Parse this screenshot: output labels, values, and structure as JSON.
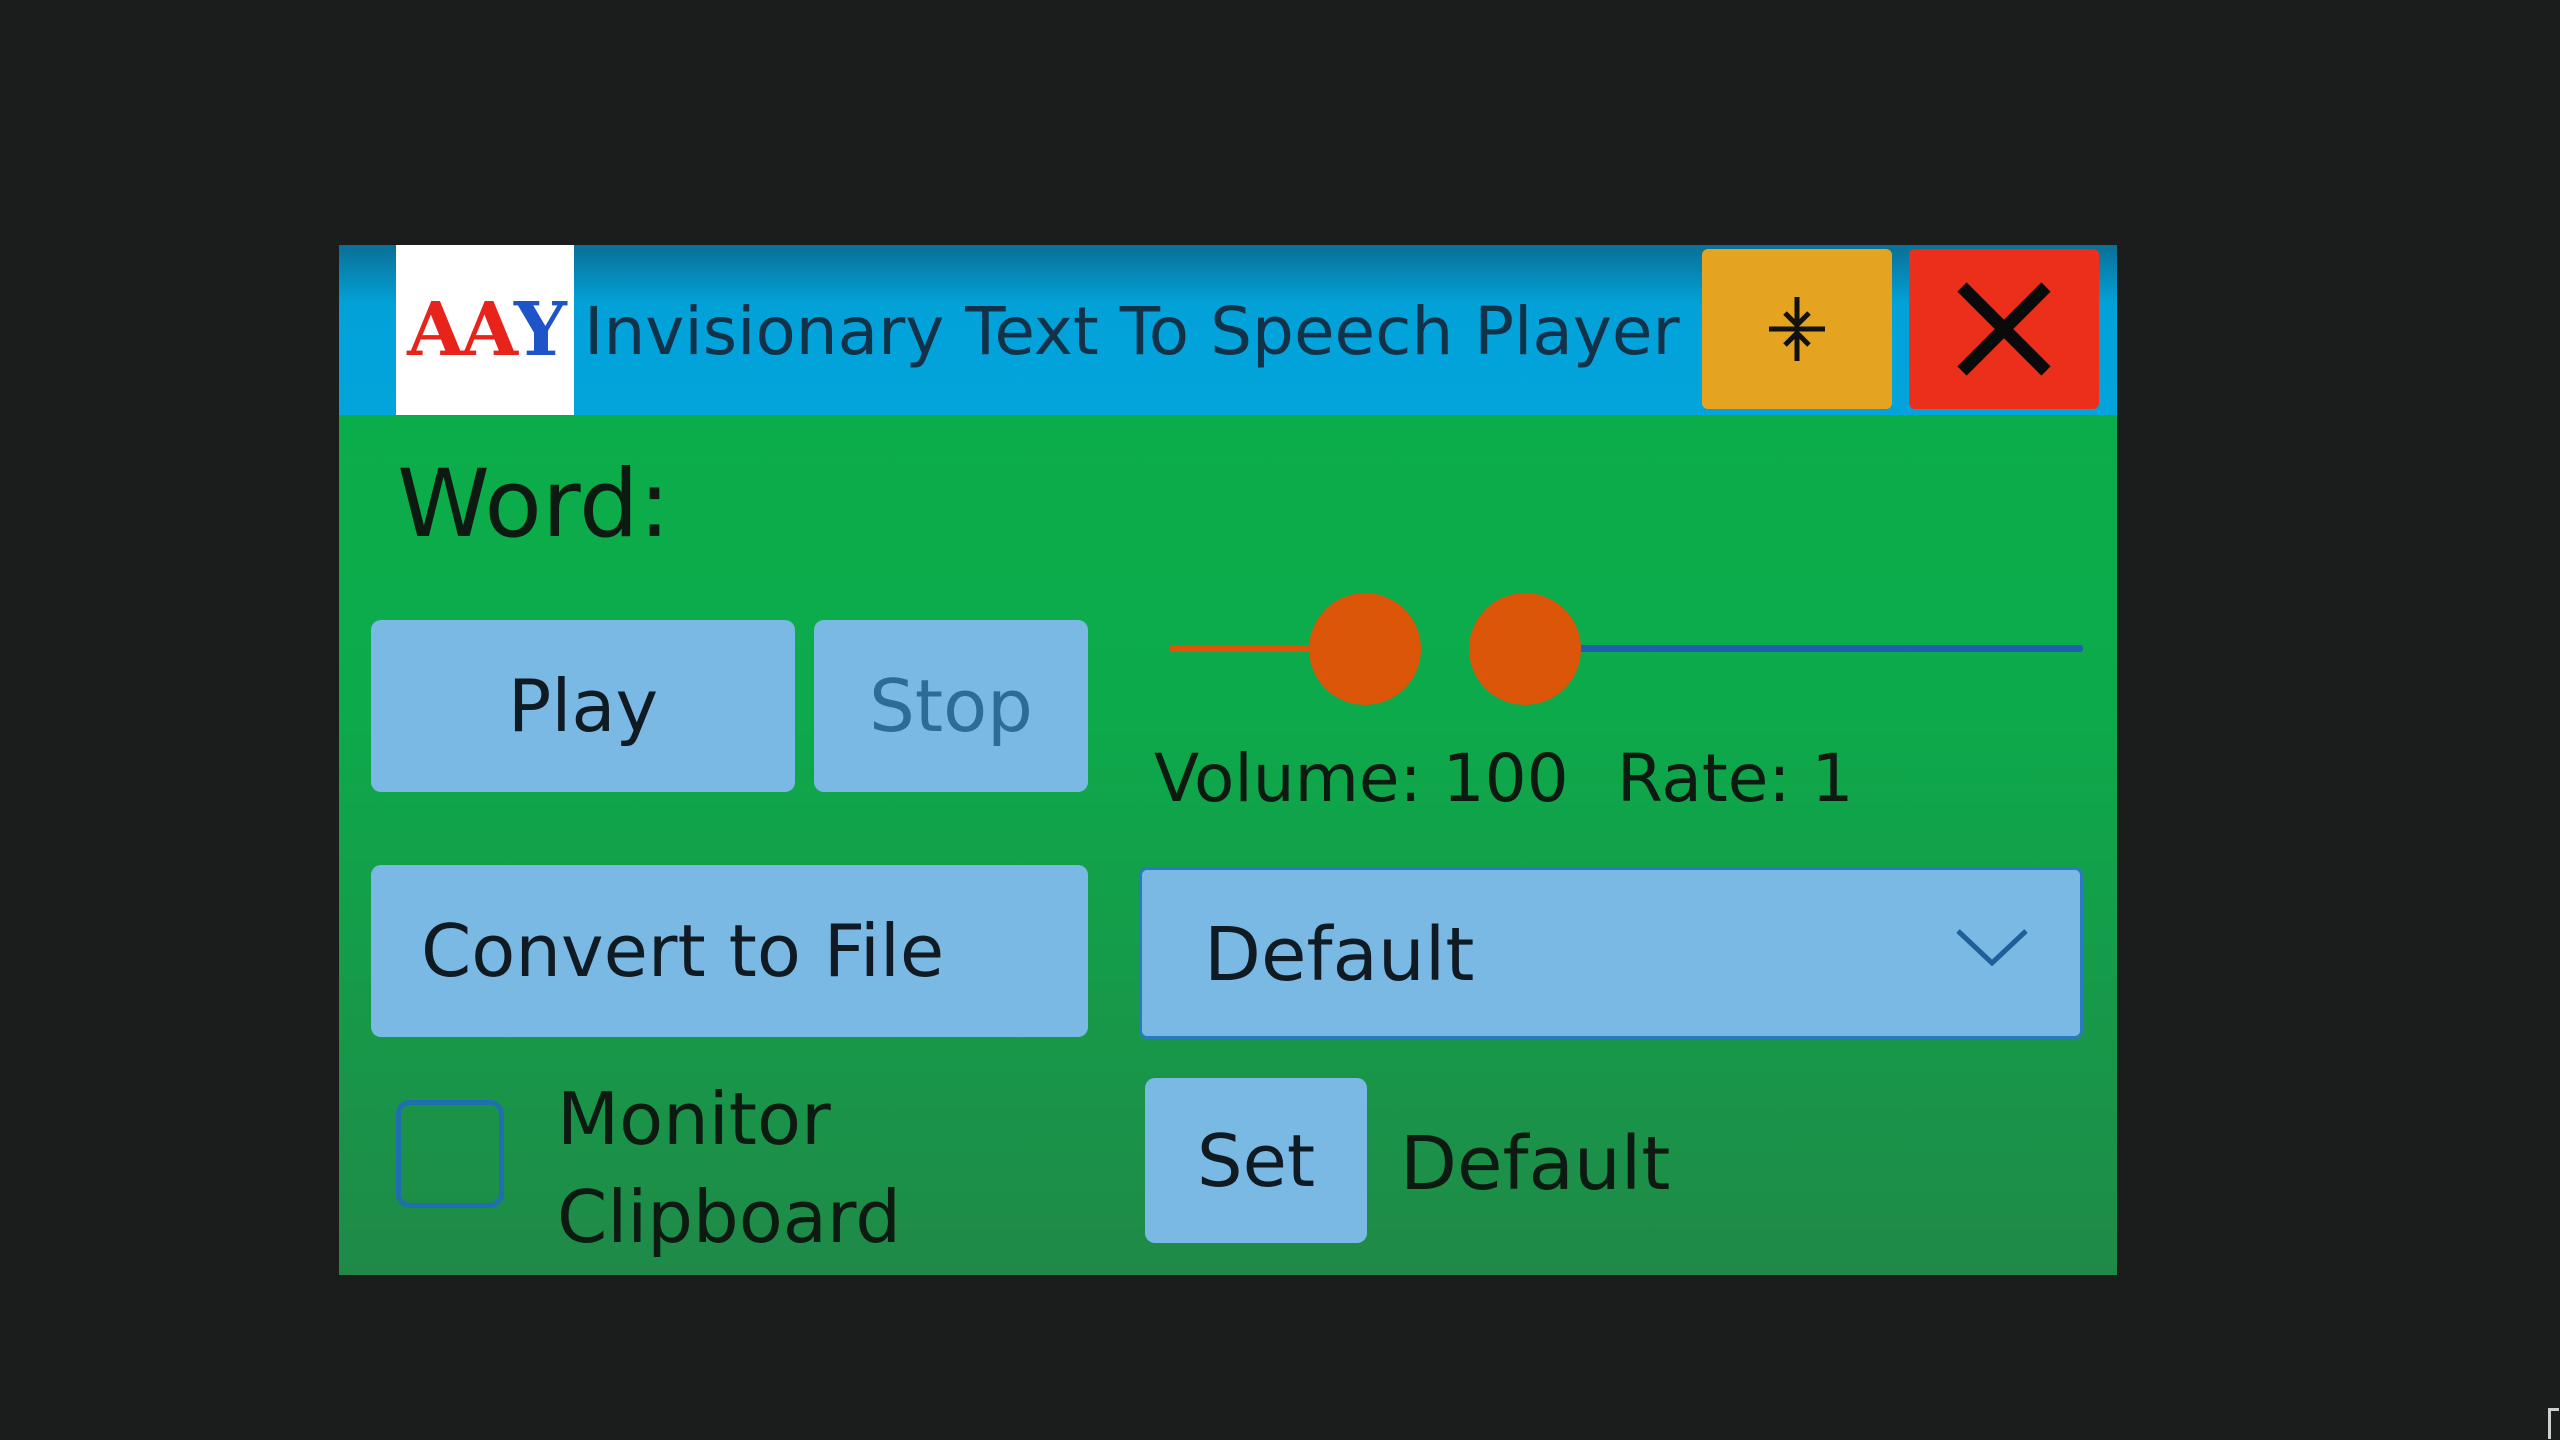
{
  "window": {
    "logo_letters": [
      "A",
      "A",
      "Y"
    ],
    "title": "Invisionary Text To Speech Player",
    "compact_icon": "collapse-vertical-icon",
    "close_icon": "close-x-icon"
  },
  "word": {
    "label": "Word:"
  },
  "controls": {
    "play_label": "Play",
    "stop_label": "Stop",
    "convert_label": "Convert to File"
  },
  "sliders": {
    "volume_label": "Volume: 100",
    "rate_label": "Rate: 1",
    "volume_value": 100,
    "rate_value": 1
  },
  "voice": {
    "dropdown_value": "Default",
    "set_label": "Set",
    "current_voice": "Default"
  },
  "monitor": {
    "label_line1": "Monitor",
    "label_line2": "Clipboard",
    "checked": false
  },
  "colors": {
    "titlebar": "#02a4db",
    "body": "#0aaf4a",
    "button": "#79b9e3",
    "compact_button": "#e4a420",
    "close_button": "#ec2f1a",
    "slider_thumb": "#db5608",
    "slider_fill": "#db5608",
    "slider_track": "#1e5fb0"
  }
}
